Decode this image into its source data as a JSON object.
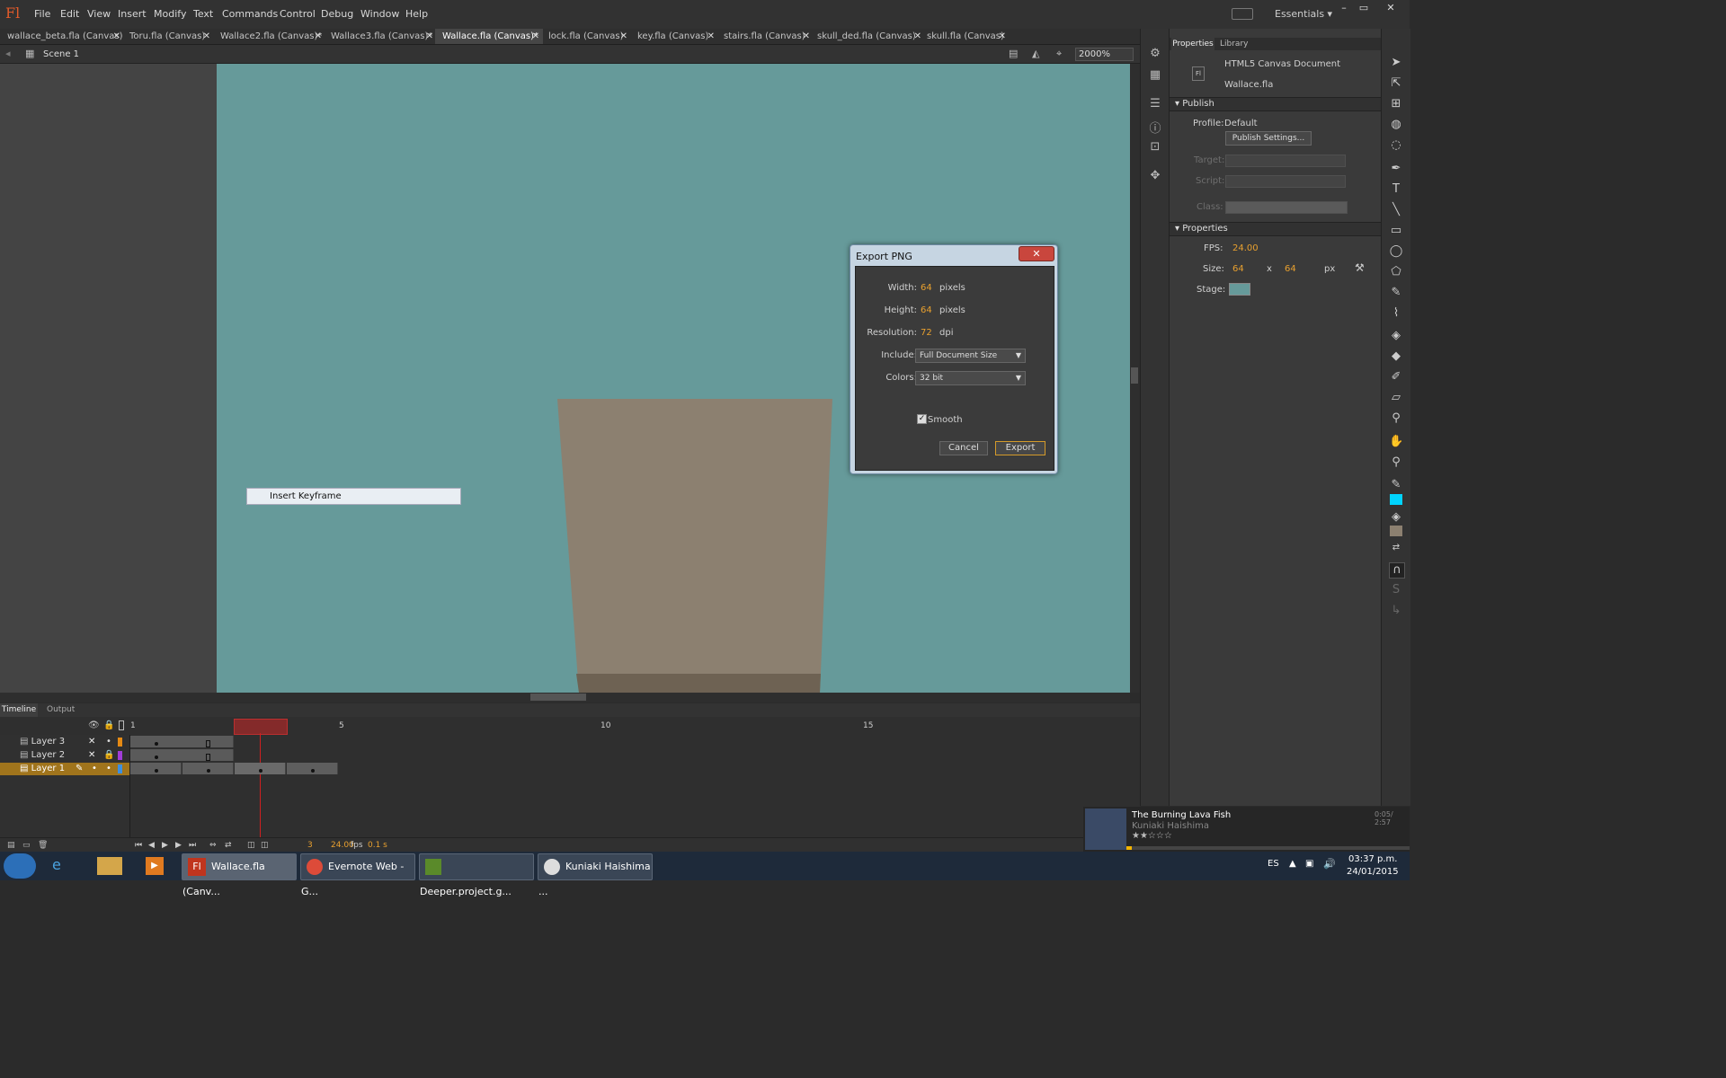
{
  "app": {
    "logo": "Fl",
    "menu": [
      "File",
      "Edit",
      "View",
      "Insert",
      "Modify",
      "Text",
      "Commands",
      "Control",
      "Debug",
      "Window",
      "Help"
    ],
    "workspace": "Essentials",
    "window_buttons": [
      "–",
      "▭",
      "✕"
    ]
  },
  "tabs": [
    {
      "label": "wallace_beta.fla (Canvas)",
      "active": false
    },
    {
      "label": "Toru.fla (Canvas)",
      "active": false
    },
    {
      "label": "Wallace2.fla (Canvas)*",
      "active": false
    },
    {
      "label": "Wallace3.fla (Canvas)*",
      "active": false
    },
    {
      "label": "Wallace.fla (Canvas)*",
      "active": true
    },
    {
      "label": "lock.fla (Canvas)",
      "active": false
    },
    {
      "label": "key.fla (Canvas)",
      "active": false
    },
    {
      "label": "stairs.fla (Canvas)",
      "active": false
    },
    {
      "label": "skull_ded.fla (Canvas)",
      "active": false
    },
    {
      "label": "skull.fla (Canvas)",
      "active": false
    }
  ],
  "scene": {
    "name": "Scene 1",
    "zoom": "2000%"
  },
  "context_menu": {
    "item": "Insert Keyframe"
  },
  "dialog": {
    "title": "Export PNG",
    "close": "✕",
    "width_label": "Width:",
    "width_value": "64",
    "width_unit": "pixels",
    "height_label": "Height:",
    "height_value": "64",
    "height_unit": "pixels",
    "resolution_label": "Resolution:",
    "resolution_value": "72",
    "resolution_unit": "dpi",
    "include_label": "Include:",
    "include_value": "Full Document Size",
    "colors_label": "Colors:",
    "colors_value": "32 bit",
    "smooth_label": "Smooth",
    "smooth_checked": true,
    "cancel": "Cancel",
    "export": "Export"
  },
  "properties": {
    "tabs": [
      "Properties",
      "Library"
    ],
    "doc_type": "HTML5 Canvas Document",
    "doc_name": "Wallace.fla",
    "publish_section": "Publish",
    "profile_label": "Profile:",
    "profile_value": "Default",
    "publish_settings": "Publish Settings...",
    "target_label": "Target:",
    "script_label": "Script:",
    "class_label": "Class:",
    "properties_section": "Properties",
    "fps_label": "FPS:",
    "fps_value": "24.00",
    "size_label": "Size:",
    "size_w": "64",
    "size_x": "x",
    "size_h": "64",
    "size_unit": "px",
    "stage_label": "Stage:",
    "stage_color": "#669a9a"
  },
  "timeline": {
    "tabs": [
      "Timeline",
      "Output"
    ],
    "frame_numbers": [
      "1",
      "5",
      "10",
      "15"
    ],
    "layers": [
      {
        "name": "Layer 3",
        "selected": false
      },
      {
        "name": "Layer 2",
        "selected": false
      },
      {
        "name": "Layer 1",
        "selected": true
      }
    ],
    "current_frame": "3",
    "fps": "24.00",
    "fps_unit": "fps",
    "time": "0.1 s"
  },
  "player": {
    "track": "The Burning Lava Fish",
    "artist": "Kuniaki Haishima",
    "time": "0:05/ 2:57",
    "stars": "★★☆☆☆"
  },
  "taskbar": {
    "items": [
      {
        "label": "Wallace.fla (Canv...",
        "active": true
      },
      {
        "label": "Evernote Web - G...",
        "active": false
      },
      {
        "label": "Deeper.project.g...",
        "active": false
      },
      {
        "label": "Kuniaki Haishima ...",
        "active": false
      }
    ],
    "lang": "ES",
    "time": "03:37 p.m.",
    "date": "24/01/2015"
  },
  "colors": {
    "stage": "#669a9a",
    "cup": "#8c8070",
    "cup_base": "#6e6253",
    "accent": "#e8a02f"
  }
}
